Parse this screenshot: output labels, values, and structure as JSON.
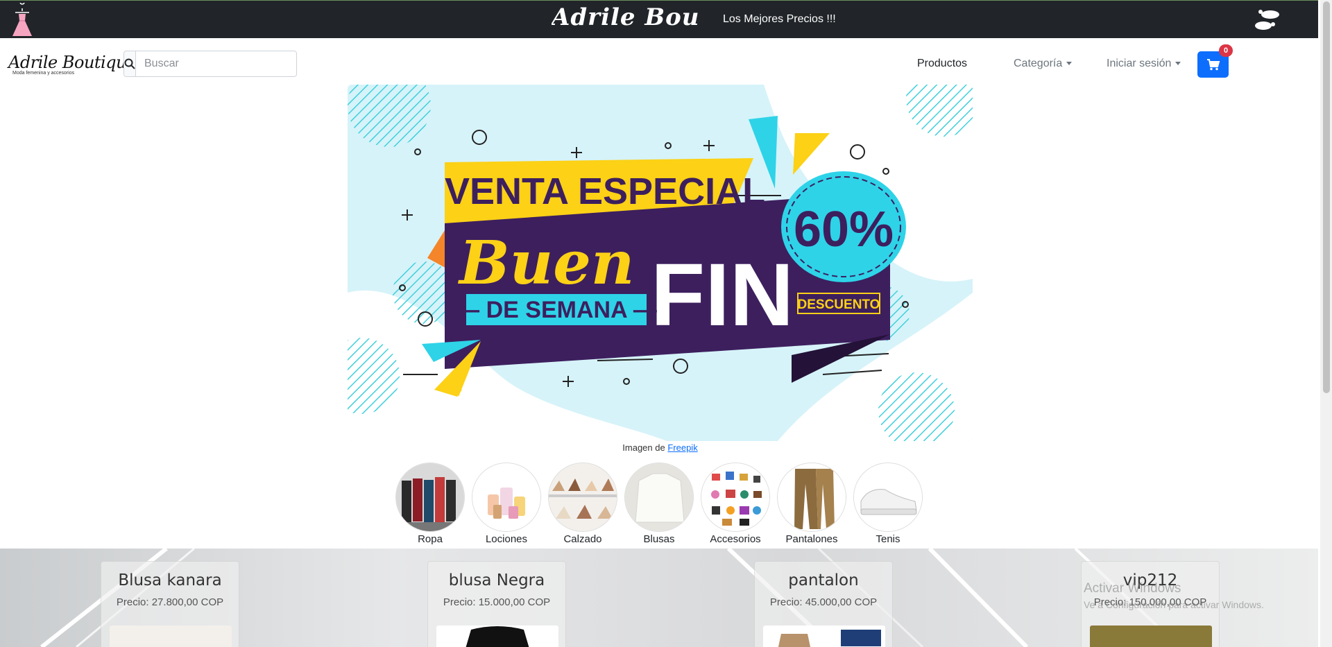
{
  "topbar": {
    "brand": "Adrile Bou",
    "tagline": "Los Mejores Precios !!!"
  },
  "navbar": {
    "logo": "Adrile Boutique",
    "logo_sub": "Moda femenina y accesorios",
    "search_placeholder": "Buscar",
    "links": {
      "productos": "Productos",
      "categoria": "Categoría",
      "login": "Iniciar sesión"
    },
    "cart_count": "0"
  },
  "hero": {
    "line1": "VENTA ESPECIAL",
    "line2a": "Buen",
    "line2b": "FIN",
    "line3": "— DE SEMANA —",
    "discount": "60%",
    "discount_label": "DESCUENTO",
    "credit_prefix": "Imagen de",
    "credit_link": "Freepik"
  },
  "categories": [
    {
      "label": "Ropa"
    },
    {
      "label": "Lociones"
    },
    {
      "label": "Calzado"
    },
    {
      "label": "Blusas"
    },
    {
      "label": "Accesorios"
    },
    {
      "label": "Pantalones"
    },
    {
      "label": "Tenis"
    }
  ],
  "products": [
    {
      "name": "Blusa kanara",
      "price": "Precio: 27.800,00 COP"
    },
    {
      "name": "blusa Negra",
      "price": "Precio: 15.000,00 COP"
    },
    {
      "name": "pantalon",
      "price": "Precio: 45.000,00 COP"
    },
    {
      "name": "vip212",
      "price": "Precio: 150.000,00 COP"
    }
  ],
  "watermark": {
    "title": "Activar Windows",
    "subtitle": "Ve a Configuración para activar Windows."
  },
  "colors": {
    "topbar": "#212529",
    "primary": "#0d6efd",
    "badge": "#dc3545",
    "hero_yellow": "#fcd116",
    "hero_purple": "#3d1f5e",
    "hero_cyan": "#2ed3e8"
  }
}
